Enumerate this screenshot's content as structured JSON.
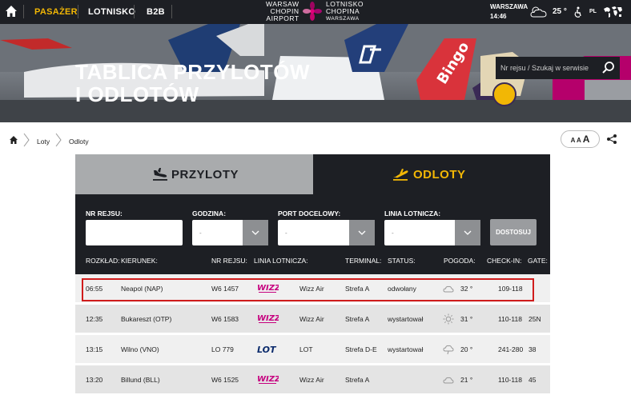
{
  "topbar": {
    "nav": [
      "PASAŻER",
      "LOTNISKO",
      "B2B"
    ],
    "logo_left": [
      "WARSAW",
      "CHOPIN",
      "AIRPORT"
    ],
    "logo_right": [
      "LOTNISKO",
      "CHOPINA",
      "WARSZAWA"
    ],
    "city": "WARSZAWA",
    "time": "14:46",
    "temperature": "25 °",
    "lang": "PL"
  },
  "hero": {
    "title_line1": "TABLICA PRZYLOTÓW",
    "title_line2": "I ODLOTÓW",
    "search_placeholder": "Nr rejsu / Szukaj w serwisie"
  },
  "breadcrumb": {
    "items": [
      "Loty",
      "Odloty"
    ],
    "font_small": "A A ",
    "font_big": "A"
  },
  "tabs": {
    "arrivals": "PRZYLOTY",
    "departures": "ODLOTY"
  },
  "filters": {
    "flight_no_label": "NR REJSU:",
    "hour_label": "GODZINA:",
    "hour_value": "-",
    "port_label": "PORT DOCELOWY:",
    "port_value": "-",
    "airline_label": "LINIA LOTNICZA:",
    "airline_value": "-",
    "adjust_button": "DOSTOSUJ"
  },
  "columns": [
    "ROZKŁAD:",
    "KIERUNEK:",
    "NR REJSU:",
    "LINIA LOTNICZA:",
    "TERMINAL:",
    "STATUS:",
    "POGODA:",
    "CHECK-IN:",
    "GATE:"
  ],
  "flights": [
    {
      "time": "06:55",
      "destination": "Neapol (NAP)",
      "flight": "W6 1457",
      "airline_logo": "WIZZ",
      "airline": "Wizz Air",
      "terminal": "Strefa A",
      "status": "odwołany",
      "weather_icon": "cloud-icon",
      "temp": "32 °",
      "checkin": "109-118",
      "gate": ""
    },
    {
      "time": "12:35",
      "destination": "Bukareszt (OTP)",
      "flight": "W6 1583",
      "airline_logo": "WIZZ",
      "airline": "Wizz Air",
      "terminal": "Strefa A",
      "status": "wystartował",
      "weather_icon": "sun-icon",
      "temp": "31 °",
      "checkin": "110-118",
      "gate": "25N"
    },
    {
      "time": "13:15",
      "destination": "Wilno (VNO)",
      "flight": "LO 779",
      "airline_logo": "LOT",
      "airline": "LOT",
      "terminal": "Strefa D-E",
      "status": "wystartował",
      "weather_icon": "rain-icon",
      "temp": "20 °",
      "checkin": "241-280",
      "gate": "38"
    },
    {
      "time": "13:20",
      "destination": "Billund (BLL)",
      "flight": "W6 1525",
      "airline_logo": "WIZZ",
      "airline": "Wizz Air",
      "terminal": "Strefa A",
      "status": "",
      "weather_icon": "cloud-icon",
      "temp": "21 °",
      "checkin": "110-118",
      "gate": "45"
    }
  ],
  "colors": {
    "accent": "#f2b705",
    "dark": "#1d1f24",
    "wizz": "#c6007e",
    "lot": "#0a2a6b",
    "highlight": "#d01c1c"
  }
}
